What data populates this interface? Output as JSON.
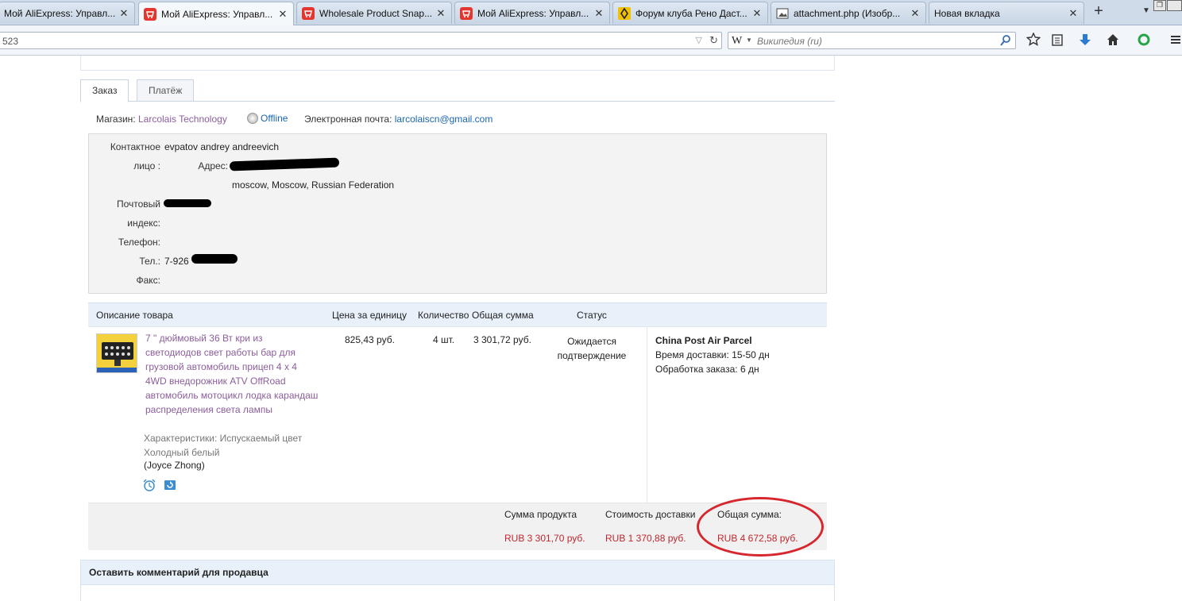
{
  "browser": {
    "tabs": [
      {
        "title": "Мой AliExpress: Управл...",
        "favicon": "partial"
      },
      {
        "title": "Мой AliExpress: Управл...",
        "favicon": "aliexpress-cart"
      },
      {
        "title": "Wholesale Product Snap...",
        "favicon": "aliexpress-cart"
      },
      {
        "title": "Мой AliExpress: Управл...",
        "favicon": "aliexpress-cart"
      },
      {
        "title": "Форум клуба Рено Даст...",
        "favicon": "renault"
      },
      {
        "title": "attachment.php (Изобр...",
        "favicon": "image"
      },
      {
        "title": "Новая вкладка",
        "favicon": "none"
      }
    ],
    "url_text": "523",
    "search_placeholder": "Википедия (ru)",
    "search_engine_glyph": "W",
    "close_glyph": "✕",
    "new_tab_glyph": "+"
  },
  "order_tabs": {
    "order": "Заказ",
    "payment": "Платёж"
  },
  "store": {
    "label": "Магазин:",
    "name": "Larcolais Technology",
    "status": "Offline",
    "email_label": "Электронная почта:",
    "email": "larcolaiscn@gmail.com"
  },
  "contact": {
    "contact_label_1": "Контактное",
    "contact_label_2": "лицо :",
    "contact_name": "evpatov andrey andreevich",
    "address_label": "Адрес:",
    "address_city": "moscow, Moscow, Russian Federation",
    "postal_label_1": "Почтовый",
    "postal_label_2": "индекс:",
    "phone_label": "Телефон:",
    "mobile_label": "Тел.:",
    "mobile_prefix": "7-926",
    "fax_label": "Факс:"
  },
  "table": {
    "headers": {
      "description": "Описание товара",
      "unit_price": "Цена за единицу",
      "quantity": "Количество",
      "total": "Общая сумма",
      "status": "Статус"
    },
    "item": {
      "name": "7 \" дюймовый 36 Вт кри из светодиодов свет работы бар для грузовой автомобиль прицеп 4 x 4 4WD внедорожник ATV OffRoad автомобиль мотоцикл лодка карандаш распределения света лампы",
      "characteristics": "Характеристики: Испускаемый цвет Холодный белый",
      "seller": "(Joyce Zhong)",
      "unit_price": "825,43 руб.",
      "quantity": "4 шт.",
      "total": "3 301,72 руб.",
      "status_line1": "Ожидается",
      "status_line2": "подтверждение"
    },
    "shipping": {
      "method": "China Post Air Parcel",
      "delivery_label": "Время доставки:",
      "delivery_time": "15-50 дн",
      "processing_label": "Обработка заказа:",
      "processing_time": "6 дн"
    }
  },
  "totals": {
    "product_sum_label": "Сумма продукта",
    "product_sum": "RUB 3 301,70 руб.",
    "shipping_cost_label": "Стоимость доставки",
    "shipping_cost": "RUB 1 370,88 руб.",
    "grand_total_label": "Общая сумма:",
    "grand_total": "RUB 4 672,58 руб."
  },
  "comment": {
    "title": "Оставить комментарий для продавца"
  },
  "colors": {
    "accent_red": "#c0262c",
    "link_purple": "#8b5d9b",
    "link_blue": "#1a65b3",
    "annotation_red": "#d7272e"
  }
}
